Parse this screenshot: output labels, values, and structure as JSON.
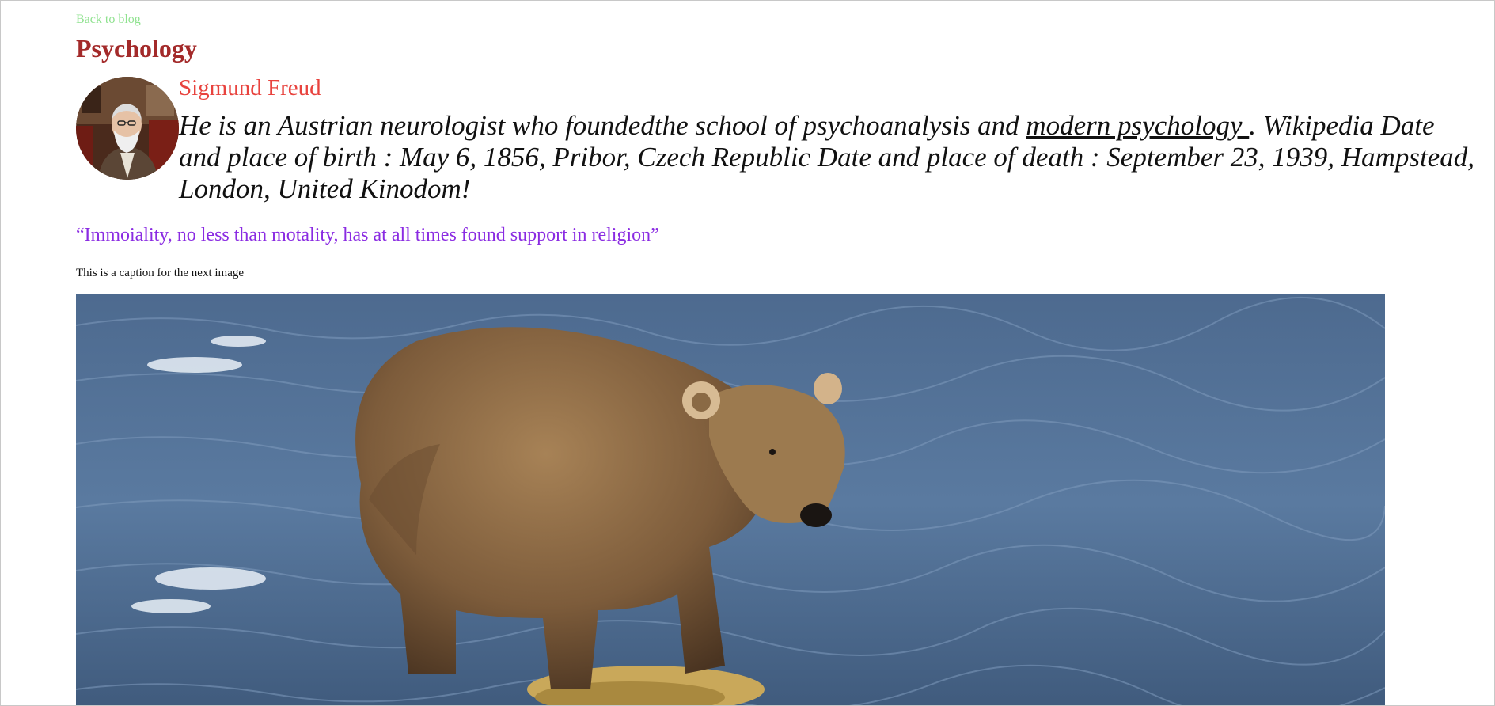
{
  "nav": {
    "back_label": "Back to blog"
  },
  "post": {
    "title": "Psychology",
    "author": {
      "name": "Sigmund Freud",
      "avatar_alt": "Portrait of Sigmund Freud"
    },
    "bio": {
      "before_link": "He is an Austrian neurologist who foundedthe school of psychoanalysis and ",
      "link_text": "modern psychology ",
      "after_link": ". Wikipedia Date and place of birth : May 6, 1856, Pribor, Czech Republic Date and place of death : September 23, 1939, Hampstead, London, United Kinodom!"
    },
    "quote": "“Immoiality, no less than motality, has at all times found support in religion”",
    "caption": "This is a caption for the next image",
    "image_alt": "Brown bear standing in a river"
  },
  "colors": {
    "back_link": "#8fe28f",
    "title": "#a32a2a",
    "author": "#e8433e",
    "quote": "#8a2be2"
  }
}
